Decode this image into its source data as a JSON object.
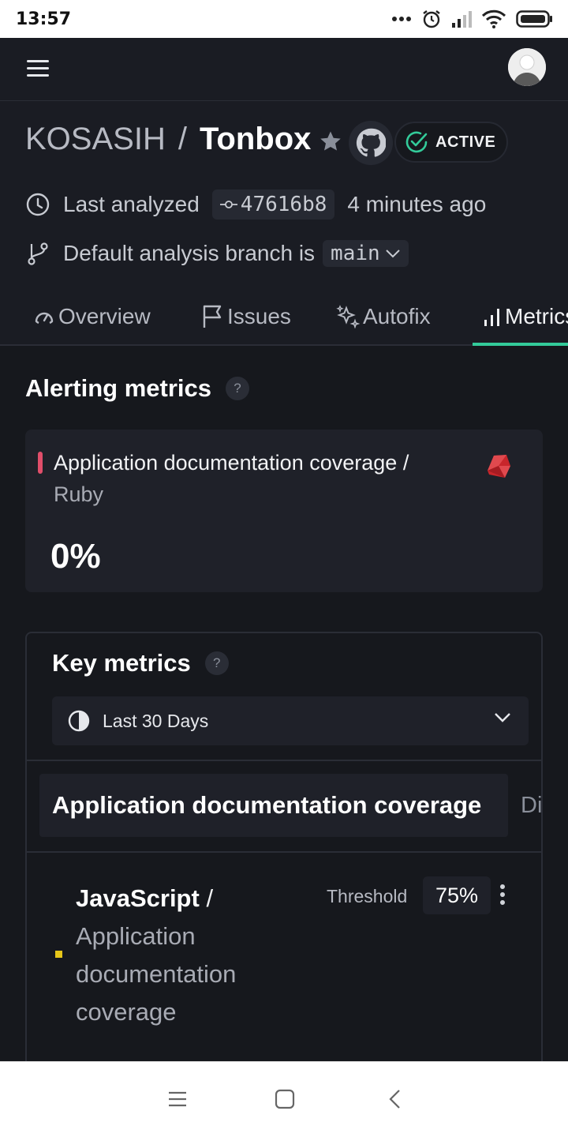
{
  "status_bar": {
    "time": "13:57"
  },
  "repo": {
    "owner": "KOSASIH",
    "separator": "/",
    "name": "Tonbox",
    "status": "ACTIVE",
    "last_analyzed_label": "Last analyzed",
    "commit": "47616b8",
    "analyzed_ago": "4 minutes ago",
    "default_branch_label": "Default analysis branch is",
    "default_branch": "main"
  },
  "tabs": [
    {
      "label": "Overview",
      "icon": "gauge-icon"
    },
    {
      "label": "Issues",
      "icon": "flag-icon"
    },
    {
      "label": "Autofix",
      "icon": "sparkle-icon"
    },
    {
      "label": "Metrics",
      "icon": "bar-chart-icon",
      "active": true
    }
  ],
  "alerting": {
    "title": "Alerting metrics",
    "help": "?",
    "card": {
      "metric": "Application documentation coverage",
      "separator": "/",
      "language": "Ruby",
      "value": "0%",
      "bar_color": "#e04e6a"
    }
  },
  "key_metrics": {
    "title": "Key metrics",
    "help": "?",
    "range": "Last 30 Days",
    "metric_tabs": [
      "Application documentation coverage",
      "Di"
    ],
    "row": {
      "language": "JavaScript",
      "separator": "/",
      "metric": "Application documentation coverage",
      "threshold_label": "Threshold",
      "threshold_value": "75%"
    }
  },
  "colors": {
    "accent": "#33cb9a",
    "background": "#16181d",
    "surface": "#1f2129"
  }
}
